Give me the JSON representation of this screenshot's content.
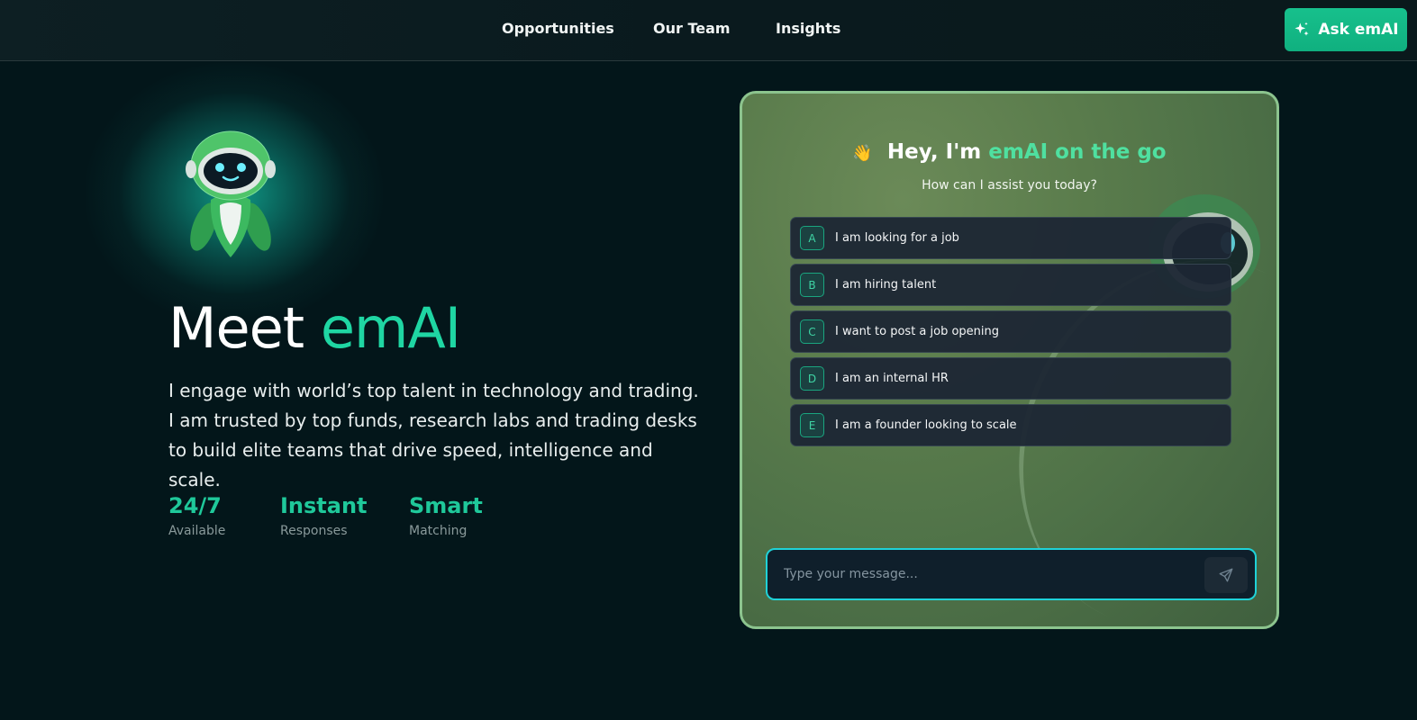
{
  "header": {
    "nav": [
      "Opportunities",
      "Our Team",
      "Insights"
    ],
    "ask_button": "Ask emAI"
  },
  "hero": {
    "title_prefix": "Meet",
    "title_accent": "emAI",
    "description": "I engage with world’s top talent in technology and trading. I am trusted by top funds, research labs and trading desks to build elite teams that drive speed, intelligence and scale.",
    "stats": [
      {
        "value": "24/7",
        "label": "Available"
      },
      {
        "value": "Instant",
        "label": "Responses"
      },
      {
        "value": "Smart",
        "label": "Matching"
      }
    ]
  },
  "chat": {
    "wave": "👋",
    "greeting_prefix": "Hey, I'm",
    "greeting_accent": "emAI on the go",
    "subtitle": "How can I assist you today?",
    "options": [
      {
        "key": "A",
        "label": "I am looking for a job"
      },
      {
        "key": "B",
        "label": "I am hiring talent"
      },
      {
        "key": "C",
        "label": "I want to post a job opening"
      },
      {
        "key": "D",
        "label": "I am an internal HR"
      },
      {
        "key": "E",
        "label": "I am a founder looking to scale"
      }
    ],
    "input_placeholder": "Type your message..."
  },
  "colors": {
    "accent": "#1fd6a3",
    "background": "#03161a",
    "button": "#12b886",
    "panel_border": "#8cc48e",
    "input_border": "#1fd2d8"
  },
  "icons": {
    "ask_button": "sparkle-icon",
    "send": "send-icon",
    "mascot": "robot-mascot"
  }
}
